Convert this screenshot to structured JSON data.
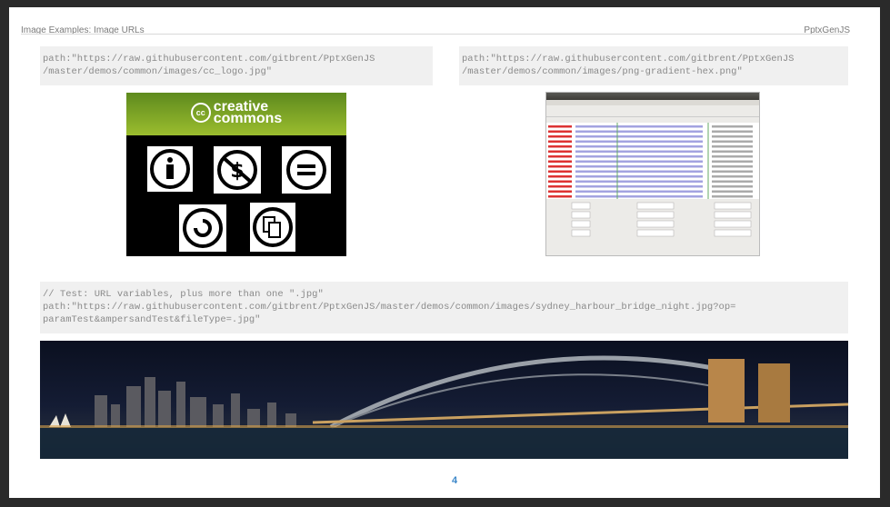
{
  "header": {
    "title": "Image Examples: Image URLs",
    "brand": "PptxGenJS"
  },
  "code_blocks": [
    {
      "line1": "path:\"https://raw.githubusercontent.com/gitbrent/PptxGenJS",
      "line2": "/master/demos/common/images/cc_logo.jpg\""
    },
    {
      "line1": "path:\"https://raw.githubusercontent.com/gitbrent/PptxGenJS",
      "line2": "/master/demos/common/images/png-gradient-hex.png\""
    },
    {
      "line1": "// Test: URL variables, plus more than one \".jpg\"",
      "line2": "path:\"https://raw.githubusercontent.com/gitbrent/PptxGenJS/master/demos/common/images/sydney_harbour_bridge_night.jpg?op=",
      "line3": "paramTest&ampersandTest&fileType=.jpg\""
    }
  ],
  "images": {
    "cc_logo": {
      "logo_text": "creative commons",
      "icons": [
        "attribution-icon",
        "noncommercial-icon",
        "noderivatives-icon",
        "sharealike-icon",
        "remix-icon"
      ]
    },
    "hex_editor": {
      "description_icon": "hex-editor-screenshot"
    },
    "sydney": {
      "description_icon": "sydney-harbour-night-photo"
    }
  },
  "footer": {
    "page_number": "4"
  },
  "colors": {
    "accent": "#3a86c8",
    "code_bg": "#f0f0f0",
    "cc_green": "#7ba428"
  }
}
